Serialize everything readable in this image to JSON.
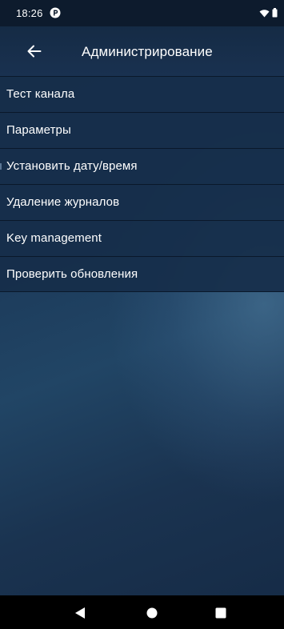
{
  "status_bar": {
    "time": "18:26",
    "app_icon": "notification-app-icon",
    "wifi_icon": "wifi-icon",
    "battery_icon": "battery-icon"
  },
  "app_bar": {
    "back_icon": "arrow-left-icon",
    "title": "Администрирование"
  },
  "menu": {
    "items": [
      {
        "label": "Тест канала"
      },
      {
        "label": "Параметры"
      },
      {
        "label": "Установить дату/время"
      },
      {
        "label": "Удаление журналов"
      },
      {
        "label": "Key management"
      },
      {
        "label": "Проверить обновления"
      }
    ]
  },
  "nav_bar": {
    "back_icon": "triangle-back-icon",
    "home_icon": "circle-home-icon",
    "recents_icon": "square-recents-icon"
  },
  "colors": {
    "status_bar_bg": "#0d1b2d",
    "app_bar_bg": "#152b45",
    "menu_item_bg": "#162e4a",
    "background_blue": "#1c3a5a",
    "text": "#ffffff"
  }
}
